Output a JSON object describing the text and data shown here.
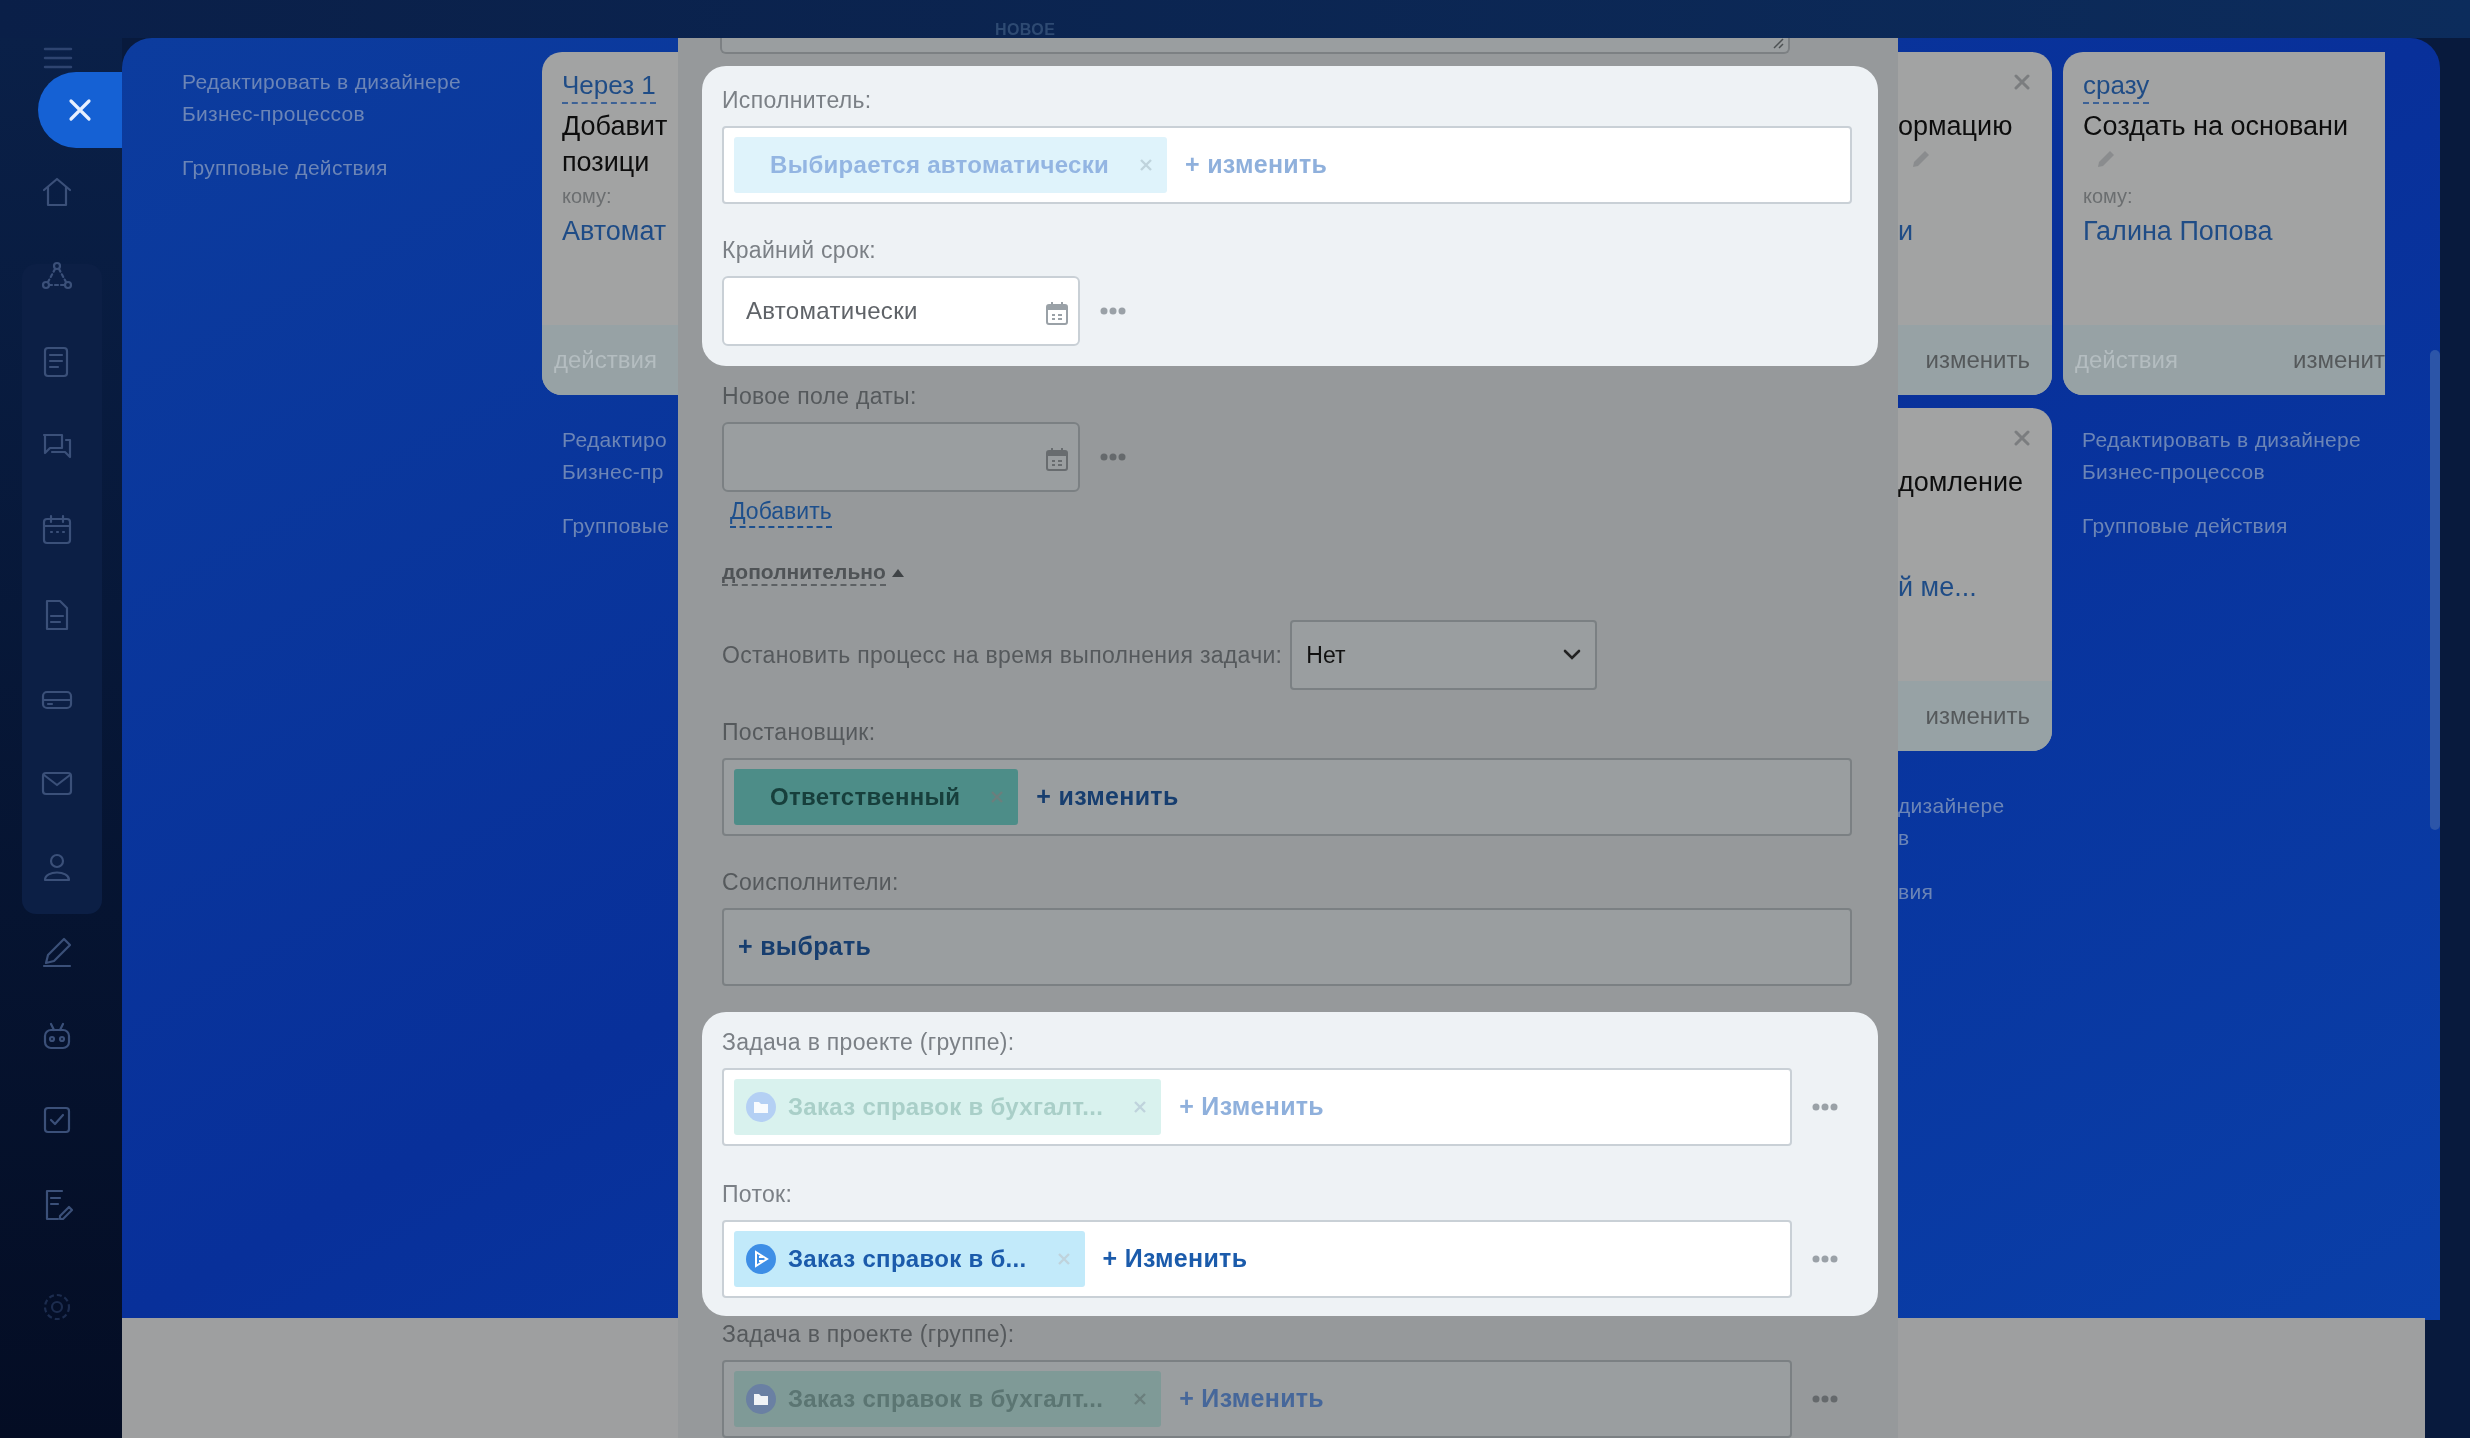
{
  "top_bar": {
    "label": "НОВОЕ"
  },
  "link_groups": [
    {
      "links": [
        "Редактировать в дизайнере\nБизнес-процессов",
        "Групповые действия"
      ]
    },
    {
      "links": [
        "Редактиро\nБизнес-пр",
        "Групповые"
      ]
    },
    {
      "links": [
        "дизайнере\nв",
        "вия"
      ]
    },
    {
      "links": [
        "Редактировать в дизайнере\nБизнес-процессов",
        "Групповые действия"
      ]
    }
  ],
  "cards": [
    {
      "timing": "Через 1",
      "title": "Добавит\nпозици",
      "to_label": "кому:",
      "recipient": "Автомат",
      "footer_left": "действия"
    },
    {
      "title": "ормацию",
      "recipient": "и",
      "footer_right": "изменить"
    },
    {
      "title": "домление",
      "recipient": "й ме...",
      "footer_right": "изменить"
    },
    {
      "timing": "сразу",
      "title": "Создать на основани",
      "to_label": "кому:",
      "recipient": "Галина Попова",
      "footer_left": "действия",
      "footer_right": "изменит"
    }
  ],
  "modal": {
    "sections": [
      {
        "highlighted": true,
        "fields": [
          {
            "kind": "selector",
            "label": "Исполнитель:",
            "chips": [
              {
                "kind": "user",
                "text": "Выбирается автоматически",
                "disabled": true
              }
            ],
            "action": "+ изменить",
            "more": false
          },
          {
            "kind": "date",
            "label": "Крайний срок:",
            "value": "Автоматически",
            "more": true
          }
        ]
      },
      {
        "highlighted": false,
        "fields": [
          {
            "kind": "date",
            "label": "Новое поле даты:",
            "more": true
          },
          {
            "kind": "link",
            "text": "Добавить"
          },
          {
            "kind": "toggle",
            "text": "дополнительно",
            "expanded": true
          },
          {
            "kind": "select",
            "label": "Остановить процесс на время выполнения задачи:",
            "value": "Нет"
          },
          {
            "kind": "selector",
            "label": "Постановщик:",
            "chips": [
              {
                "kind": "role",
                "text": "Ответственный",
                "disabled": false
              }
            ],
            "action": "+ изменить",
            "more": false
          },
          {
            "kind": "selector",
            "label": "Соисполнители:",
            "action": "+ выбрать",
            "more": false
          }
        ]
      },
      {
        "highlighted": true,
        "fields": [
          {
            "kind": "selector",
            "label": "Задача в проекте (группе):",
            "chips": [
              {
                "kind": "project",
                "text": "Заказ справок в бухгалт...",
                "disabled": true
              }
            ],
            "action": "+ Изменить",
            "more": true
          },
          {
            "kind": "selector",
            "label": "Поток:",
            "chips": [
              {
                "kind": "flow",
                "text": "Заказ справок в б...",
                "disabled": false
              }
            ],
            "action": "+ Изменить",
            "more": true
          }
        ]
      },
      {
        "highlighted": false,
        "fields": [
          {
            "kind": "selector",
            "label": "Задача в проекте (группе):",
            "chips": [
              {
                "kind": "project",
                "text": "Заказ справок в бухгалт...",
                "disabled": true
              }
            ],
            "action": "+ Изменить",
            "more": true
          }
        ]
      }
    ]
  }
}
